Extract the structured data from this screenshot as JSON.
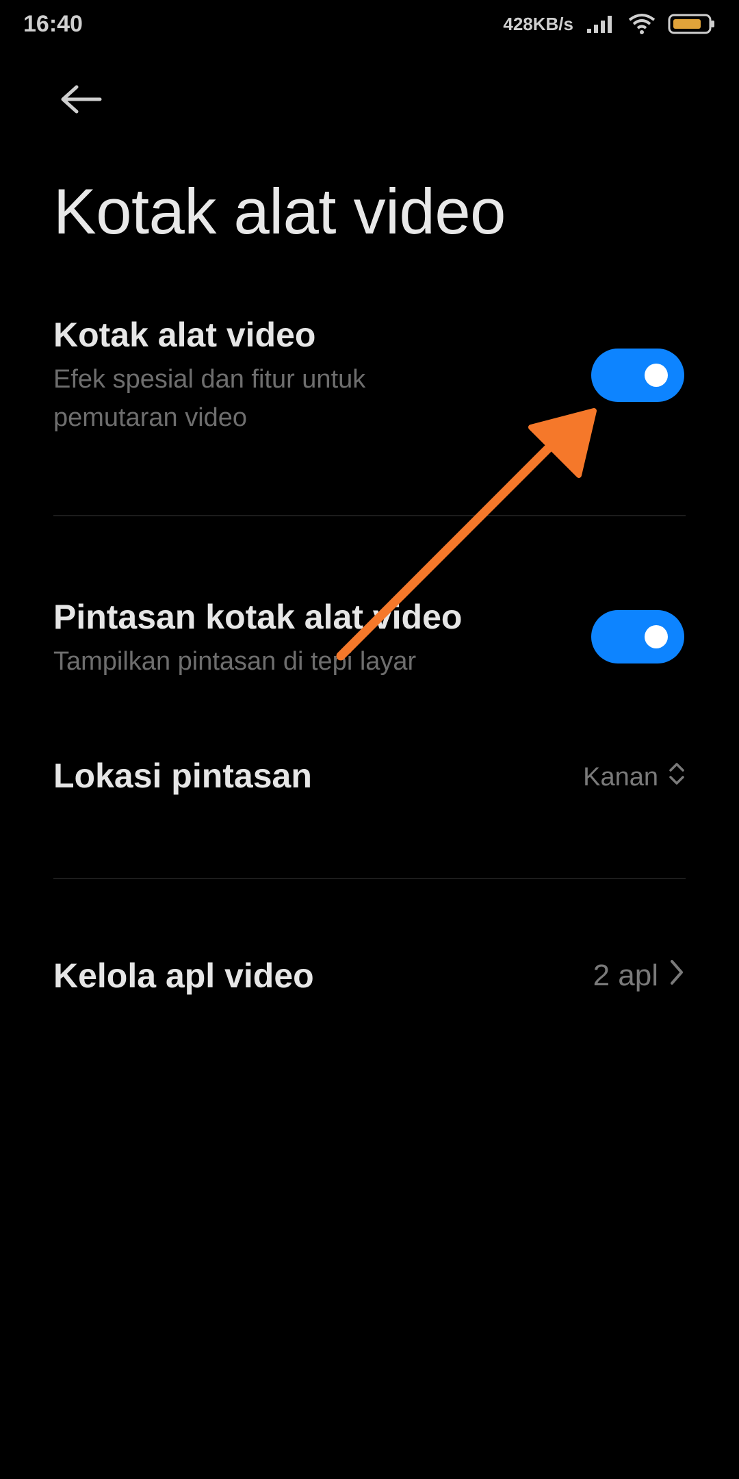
{
  "status_bar": {
    "time": "16:40",
    "net_speed": "428KB/s"
  },
  "header": {
    "back_icon": "back-arrow-icon",
    "title": "Kotak alat video"
  },
  "settings": {
    "toolbox": {
      "title": "Kotak alat video",
      "description": "Efek spesial dan fitur untuk pemutaran video",
      "enabled": true
    },
    "shortcut": {
      "title": "Pintasan kotak alat video",
      "description": "Tampilkan pintasan di tepi layar",
      "enabled": true
    },
    "shortcut_location": {
      "title": "Lokasi pintasan",
      "value": "Kanan",
      "icon": "unfold-icon"
    },
    "manage_apps": {
      "title": "Kelola apl video",
      "value": "2 apl",
      "icon": "chevron-right-icon"
    }
  },
  "annotation": {
    "arrow_color": "#f5782a"
  },
  "colors": {
    "background": "#000000",
    "toggle_on": "#0d84ff"
  }
}
